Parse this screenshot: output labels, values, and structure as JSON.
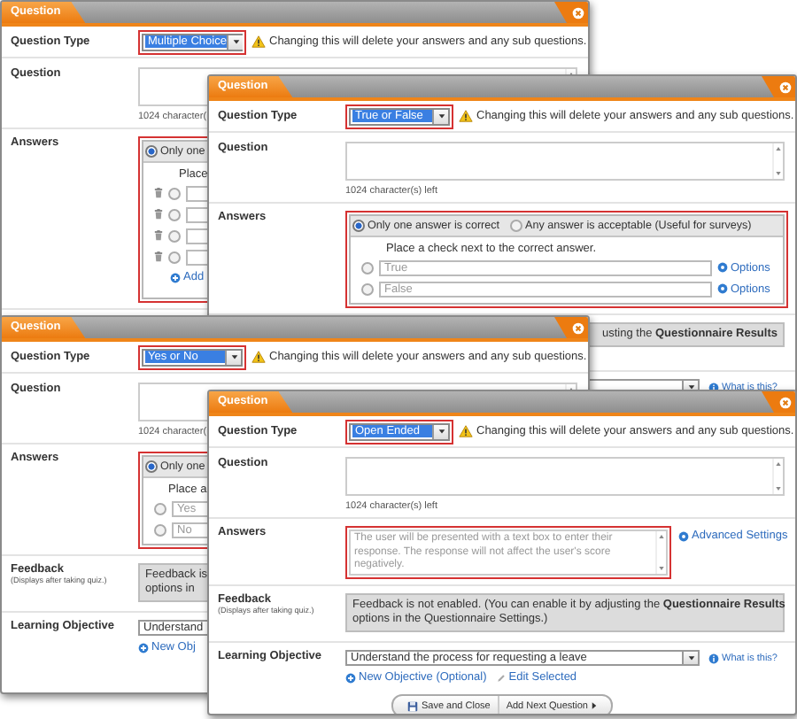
{
  "windows": [
    {
      "title": "Question",
      "question_type": {
        "label": "Question Type",
        "value": "Multiple Choice"
      },
      "warning": "Changing this will delete your answers and any sub questions.",
      "question": {
        "label": "Question",
        "counter": "1024 character("
      },
      "answers": {
        "label": "Answers",
        "kind": "choices",
        "modes": [
          {
            "label": "Only one",
            "selected": true
          }
        ],
        "instruction": "Place",
        "options": [
          {
            "checked": false,
            "deletable": true
          },
          {
            "checked": false,
            "deletable": true
          },
          {
            "checked": false,
            "deletable": true
          },
          {
            "checked": false,
            "deletable": true
          }
        ],
        "add_link": "Add"
      }
    },
    {
      "title": "Question",
      "question_type": {
        "label": "Question Type",
        "value": "True or False"
      },
      "warning": "Changing this will delete your answers and any sub questions.",
      "question": {
        "label": "Question",
        "counter": "1024 character(s) left"
      },
      "answers": {
        "label": "Answers",
        "kind": "choices",
        "modes": [
          {
            "label": "Only one answer is correct",
            "selected": true
          },
          {
            "label": "Any answer is acceptable (Useful for surveys)",
            "selected": false
          }
        ],
        "instruction": "Place a check next to the correct answer.",
        "options": [
          {
            "checked": false,
            "deletable": false,
            "placeholder": "True",
            "link": "Options"
          },
          {
            "checked": false,
            "deletable": false,
            "placeholder": "False",
            "link": "Options"
          }
        ]
      },
      "feedback": {
        "lines": [
          "usting the **Questionnaire Results**"
        ]
      },
      "learning_objective": {
        "help": "What is this?"
      }
    },
    {
      "title": "Question",
      "question_type": {
        "label": "Question Type",
        "value": "Yes or No"
      },
      "warning": "Changing this will delete your answers and any sub questions.",
      "question": {
        "label": "Question",
        "counter": "1024 character("
      },
      "answers": {
        "label": "Answers",
        "kind": "choices",
        "modes": [
          {
            "label": "Only one",
            "selected": true
          }
        ],
        "instruction": "Place a",
        "options": [
          {
            "checked": false,
            "deletable": false,
            "placeholder": "Yes"
          },
          {
            "checked": false,
            "deletable": false,
            "placeholder": "No"
          }
        ]
      },
      "feedback": {
        "label": "Feedback",
        "note": "(Displays after taking quiz.)",
        "lines": [
          "Feedback is",
          "options in"
        ]
      },
      "learning_objective": {
        "label": "Learning Objective",
        "value": "Understand",
        "links": [
          {
            "kind": "new",
            "label": "New Obj"
          }
        ]
      }
    },
    {
      "title": "Question",
      "question_type": {
        "label": "Question Type",
        "value": "Open Ended"
      },
      "warning": "Changing this will delete your answers and any sub questions.",
      "question": {
        "label": "Question",
        "counter": "1024 character(s) left"
      },
      "answers": {
        "label": "Answers",
        "kind": "open",
        "text": "The user will be presented with a text box to enter their response. The response will not affect the user's score negatively.",
        "link": "Advanced Settings"
      },
      "feedback": {
        "label": "Feedback",
        "note": "(Displays after taking quiz.)",
        "lines": [
          "Feedback is not enabled. (You can enable it by adjusting the **Questionnaire Results**",
          "options in the Questionnaire Settings.)"
        ]
      },
      "learning_objective": {
        "label": "Learning Objective",
        "value": "Understand the process for requesting a leave",
        "help": "What is this?",
        "links": [
          {
            "kind": "new",
            "label": "New Objective (Optional)"
          },
          {
            "kind": "edit",
            "label": "Edit Selected"
          }
        ]
      },
      "buttons": [
        {
          "kind": "save",
          "label": "Save and Close"
        },
        {
          "kind": "next",
          "label": "Add Next Question"
        }
      ]
    }
  ]
}
